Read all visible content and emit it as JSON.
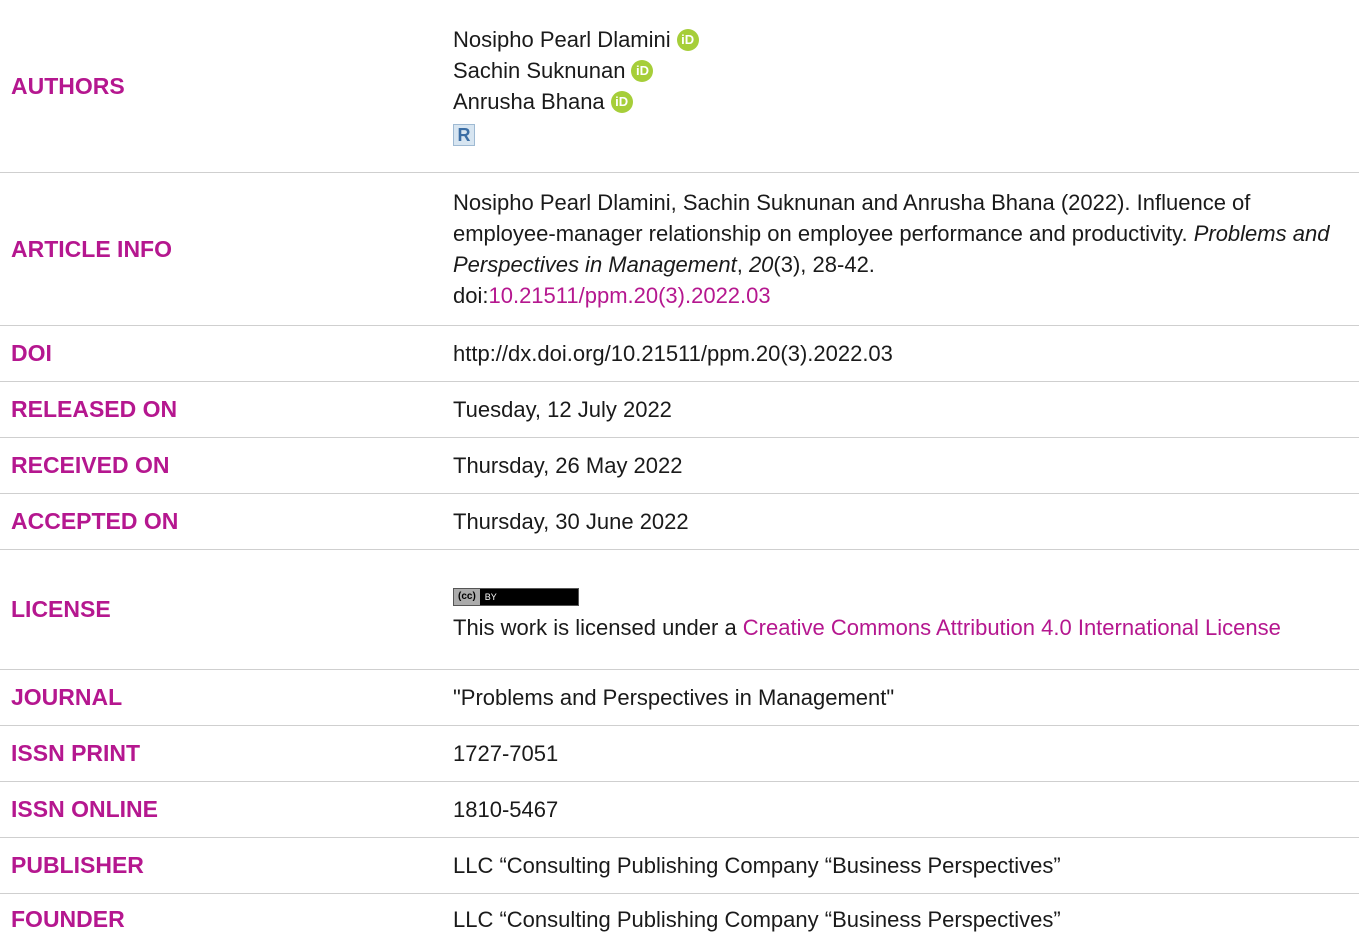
{
  "authors": {
    "label": "AUTHORS",
    "names": [
      "Nosipho Pearl Dlamini",
      "Sachin Suknunan",
      "Anrusha Bhana"
    ],
    "orcid_icon_text": "iD",
    "researcherid_icon_text": "R"
  },
  "article_info": {
    "label": "ARTICLE INFO",
    "citation_text": "Nosipho Pearl Dlamini, Sachin Suknunan and Anrusha Bhana (2022). Influence of employee-manager relationship on employee performance and productivity.",
    "journal_italic": "Problems and Perspectives in Management",
    "comma": ", ",
    "volume_italic": "20",
    "issue_pages": "(3), 28-42.",
    "doi_prefix": "doi:",
    "doi_link": "10.21511/ppm.20(3).2022.03"
  },
  "doi": {
    "label": "DOI",
    "value": "http://dx.doi.org/10.21511/ppm.20(3).2022.03"
  },
  "released_on": {
    "label": "RELEASED ON",
    "value": "Tuesday, 12 July 2022"
  },
  "received_on": {
    "label": "RECEIVED ON",
    "value": "Thursday, 26 May 2022"
  },
  "accepted_on": {
    "label": "ACCEPTED ON",
    "value": "Thursday, 30 June 2022"
  },
  "license": {
    "label": "LICENSE",
    "badge_cc": "(cc)",
    "badge_by": "BY",
    "text": "This work is licensed under a ",
    "link": "Creative Commons Attribution 4.0 International License"
  },
  "journal": {
    "label": "JOURNAL",
    "value": "\"Problems and Perspectives in Management\""
  },
  "issn_print": {
    "label": "ISSN PRINT",
    "value": "1727-7051"
  },
  "issn_online": {
    "label": "ISSN ONLINE",
    "value": "1810-5467"
  },
  "publisher": {
    "label": "PUBLISHER",
    "value": "LLC “Consulting Publishing Company “Business Perspectives”"
  },
  "founder": {
    "label": "FOUNDER",
    "value": "LLC “Consulting Publishing Company “Business Perspectives”"
  },
  "colors": {
    "accent": "#b5178f",
    "orcid": "#a6ce39",
    "text": "#1a1a1a",
    "divider": "#cfcfcf"
  }
}
